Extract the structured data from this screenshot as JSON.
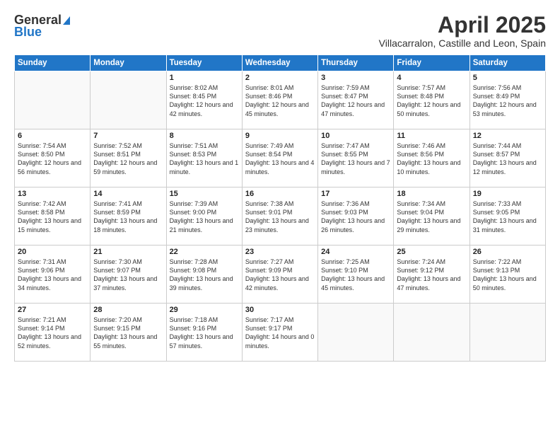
{
  "header": {
    "logo_general": "General",
    "logo_blue": "Blue",
    "month_title": "April 2025",
    "location": "Villacarralon, Castille and Leon, Spain"
  },
  "days_of_week": [
    "Sunday",
    "Monday",
    "Tuesday",
    "Wednesday",
    "Thursday",
    "Friday",
    "Saturday"
  ],
  "weeks": [
    [
      {
        "day": "",
        "info": ""
      },
      {
        "day": "",
        "info": ""
      },
      {
        "day": "1",
        "info": "Sunrise: 8:02 AM\nSunset: 8:45 PM\nDaylight: 12 hours and 42 minutes."
      },
      {
        "day": "2",
        "info": "Sunrise: 8:01 AM\nSunset: 8:46 PM\nDaylight: 12 hours and 45 minutes."
      },
      {
        "day": "3",
        "info": "Sunrise: 7:59 AM\nSunset: 8:47 PM\nDaylight: 12 hours and 47 minutes."
      },
      {
        "day": "4",
        "info": "Sunrise: 7:57 AM\nSunset: 8:48 PM\nDaylight: 12 hours and 50 minutes."
      },
      {
        "day": "5",
        "info": "Sunrise: 7:56 AM\nSunset: 8:49 PM\nDaylight: 12 hours and 53 minutes."
      }
    ],
    [
      {
        "day": "6",
        "info": "Sunrise: 7:54 AM\nSunset: 8:50 PM\nDaylight: 12 hours and 56 minutes."
      },
      {
        "day": "7",
        "info": "Sunrise: 7:52 AM\nSunset: 8:51 PM\nDaylight: 12 hours and 59 minutes."
      },
      {
        "day": "8",
        "info": "Sunrise: 7:51 AM\nSunset: 8:53 PM\nDaylight: 13 hours and 1 minute."
      },
      {
        "day": "9",
        "info": "Sunrise: 7:49 AM\nSunset: 8:54 PM\nDaylight: 13 hours and 4 minutes."
      },
      {
        "day": "10",
        "info": "Sunrise: 7:47 AM\nSunset: 8:55 PM\nDaylight: 13 hours and 7 minutes."
      },
      {
        "day": "11",
        "info": "Sunrise: 7:46 AM\nSunset: 8:56 PM\nDaylight: 13 hours and 10 minutes."
      },
      {
        "day": "12",
        "info": "Sunrise: 7:44 AM\nSunset: 8:57 PM\nDaylight: 13 hours and 12 minutes."
      }
    ],
    [
      {
        "day": "13",
        "info": "Sunrise: 7:42 AM\nSunset: 8:58 PM\nDaylight: 13 hours and 15 minutes."
      },
      {
        "day": "14",
        "info": "Sunrise: 7:41 AM\nSunset: 8:59 PM\nDaylight: 13 hours and 18 minutes."
      },
      {
        "day": "15",
        "info": "Sunrise: 7:39 AM\nSunset: 9:00 PM\nDaylight: 13 hours and 21 minutes."
      },
      {
        "day": "16",
        "info": "Sunrise: 7:38 AM\nSunset: 9:01 PM\nDaylight: 13 hours and 23 minutes."
      },
      {
        "day": "17",
        "info": "Sunrise: 7:36 AM\nSunset: 9:03 PM\nDaylight: 13 hours and 26 minutes."
      },
      {
        "day": "18",
        "info": "Sunrise: 7:34 AM\nSunset: 9:04 PM\nDaylight: 13 hours and 29 minutes."
      },
      {
        "day": "19",
        "info": "Sunrise: 7:33 AM\nSunset: 9:05 PM\nDaylight: 13 hours and 31 minutes."
      }
    ],
    [
      {
        "day": "20",
        "info": "Sunrise: 7:31 AM\nSunset: 9:06 PM\nDaylight: 13 hours and 34 minutes."
      },
      {
        "day": "21",
        "info": "Sunrise: 7:30 AM\nSunset: 9:07 PM\nDaylight: 13 hours and 37 minutes."
      },
      {
        "day": "22",
        "info": "Sunrise: 7:28 AM\nSunset: 9:08 PM\nDaylight: 13 hours and 39 minutes."
      },
      {
        "day": "23",
        "info": "Sunrise: 7:27 AM\nSunset: 9:09 PM\nDaylight: 13 hours and 42 minutes."
      },
      {
        "day": "24",
        "info": "Sunrise: 7:25 AM\nSunset: 9:10 PM\nDaylight: 13 hours and 45 minutes."
      },
      {
        "day": "25",
        "info": "Sunrise: 7:24 AM\nSunset: 9:12 PM\nDaylight: 13 hours and 47 minutes."
      },
      {
        "day": "26",
        "info": "Sunrise: 7:22 AM\nSunset: 9:13 PM\nDaylight: 13 hours and 50 minutes."
      }
    ],
    [
      {
        "day": "27",
        "info": "Sunrise: 7:21 AM\nSunset: 9:14 PM\nDaylight: 13 hours and 52 minutes."
      },
      {
        "day": "28",
        "info": "Sunrise: 7:20 AM\nSunset: 9:15 PM\nDaylight: 13 hours and 55 minutes."
      },
      {
        "day": "29",
        "info": "Sunrise: 7:18 AM\nSunset: 9:16 PM\nDaylight: 13 hours and 57 minutes."
      },
      {
        "day": "30",
        "info": "Sunrise: 7:17 AM\nSunset: 9:17 PM\nDaylight: 14 hours and 0 minutes."
      },
      {
        "day": "",
        "info": ""
      },
      {
        "day": "",
        "info": ""
      },
      {
        "day": "",
        "info": ""
      }
    ]
  ]
}
